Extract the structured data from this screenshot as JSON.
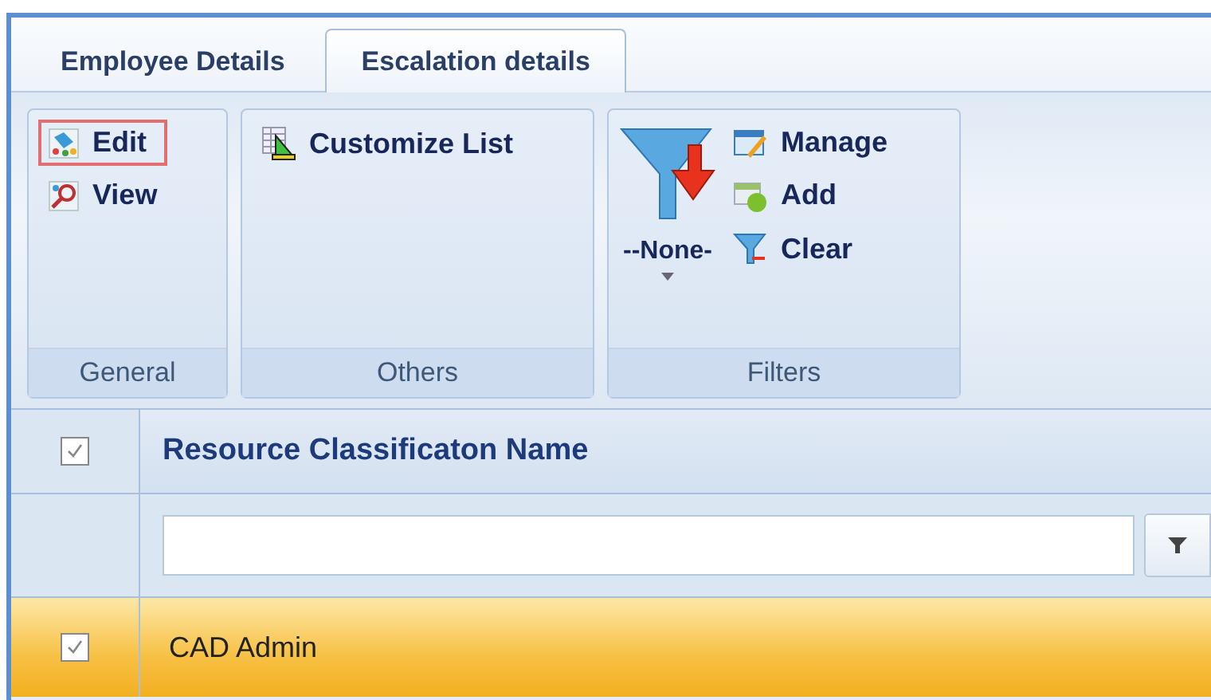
{
  "tabs": [
    {
      "label": "Employee Details",
      "selected": false
    },
    {
      "label": "Escalation details",
      "selected": true
    }
  ],
  "ribbon": {
    "groups": [
      {
        "label": "General",
        "kind": "list",
        "items": [
          {
            "label": "Edit",
            "kind": "edit",
            "focused": true
          },
          {
            "label": "View",
            "kind": "view",
            "focused": false
          }
        ]
      },
      {
        "label": "Others",
        "kind": "list",
        "items": [
          {
            "label": "Customize List",
            "kind": "customize",
            "focused": false
          }
        ]
      },
      {
        "label": "Filters",
        "kind": "filters",
        "dropdown": {
          "label": "--None-"
        },
        "items": [
          {
            "label": "Manage",
            "kind": "manage",
            "focused": false
          },
          {
            "label": "Add",
            "kind": "add",
            "focused": false
          },
          {
            "label": "Clear",
            "kind": "clear",
            "focused": false
          }
        ]
      }
    ]
  },
  "grid": {
    "header": {
      "checked": true,
      "column": "Resource Classificaton Name"
    },
    "rows": [
      {
        "checked": true,
        "selected": true,
        "name": "CAD Admin"
      }
    ]
  }
}
